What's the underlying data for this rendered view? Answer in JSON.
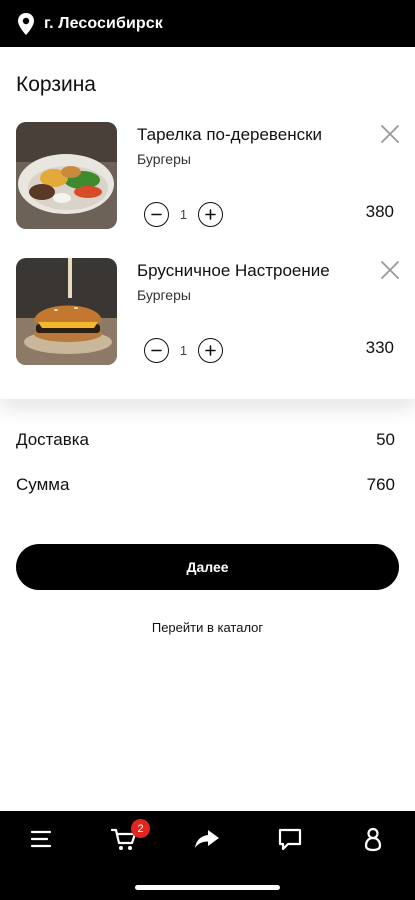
{
  "header": {
    "city": "г. Лесосибирск",
    "icon": "location-pin-icon"
  },
  "cart": {
    "title": "Корзина",
    "items": [
      {
        "name": "Тарелка по-деревенски",
        "category": "Бургеры",
        "quantity": "1",
        "price": "380"
      },
      {
        "name": "Брусничное Настроение",
        "category": "Бургеры",
        "quantity": "1",
        "price": "330"
      }
    ]
  },
  "totals": {
    "delivery_label": "Доставка",
    "delivery_value": "50",
    "sum_label": "Сумма",
    "sum_value": "760"
  },
  "actions": {
    "next_label": "Далее",
    "catalog_link": "Перейти в каталог"
  },
  "bottom_nav": {
    "items": [
      "menu-icon",
      "cart-icon",
      "share-icon",
      "chat-icon",
      "profile-icon"
    ],
    "cart_badge": "2"
  },
  "colors": {
    "bar": "#000000",
    "badge": "#e0261f",
    "background": "#ffffff"
  }
}
